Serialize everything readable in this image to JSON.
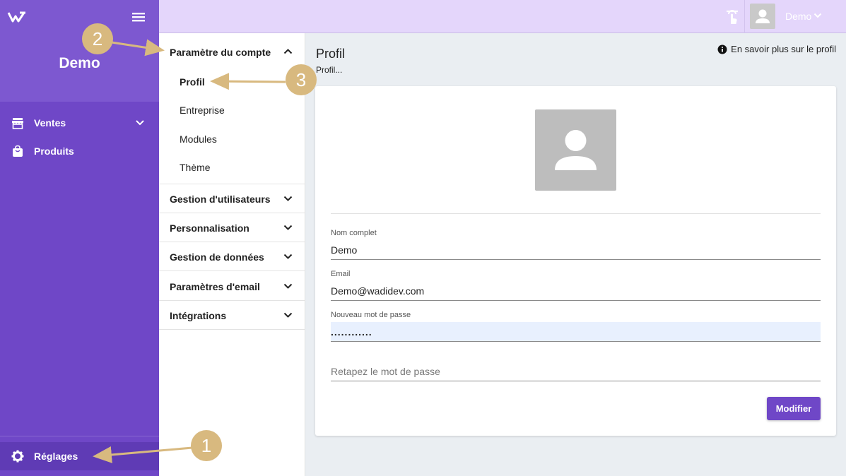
{
  "sidebar": {
    "brand": "Demo",
    "items": [
      {
        "label": "Ventes",
        "icon": "store-icon"
      },
      {
        "label": "Produits",
        "icon": "shopping-bag-icon"
      }
    ],
    "bottom": {
      "label": "Réglages",
      "icon": "gear-icon"
    }
  },
  "topbar": {
    "user": "Demo"
  },
  "settings_menu": {
    "sections": [
      {
        "label": "Paramètre du compte",
        "expanded": true,
        "items": [
          "Profil",
          "Entreprise",
          "Modules",
          "Thème"
        ]
      },
      {
        "label": "Gestion d'utilisateurs"
      },
      {
        "label": "Personnalisation"
      },
      {
        "label": "Gestion de données"
      },
      {
        "label": "Paramètres d'email"
      },
      {
        "label": "Intégrations"
      }
    ]
  },
  "main": {
    "title": "Profil",
    "subtitle": "Profil...",
    "learn_more": "En savoir plus sur le profil",
    "form": {
      "name_label": "Nom complet",
      "name_value": "Demo",
      "email_label": "Email",
      "email_value": "Demo@wadidev.com",
      "password_label": "Nouveau mot de passe",
      "password_value": "............",
      "repeat_placeholder": "Retapez le mot de passe",
      "submit_label": "Modifier"
    }
  },
  "annotations": {
    "badge_1": "1",
    "badge_2": "2",
    "badge_3": "3"
  },
  "colors": {
    "sidebar": "#6f47c7",
    "topbar": "#e4d6fb",
    "accent": "#6f47c7",
    "badge": "#d8b97f"
  }
}
